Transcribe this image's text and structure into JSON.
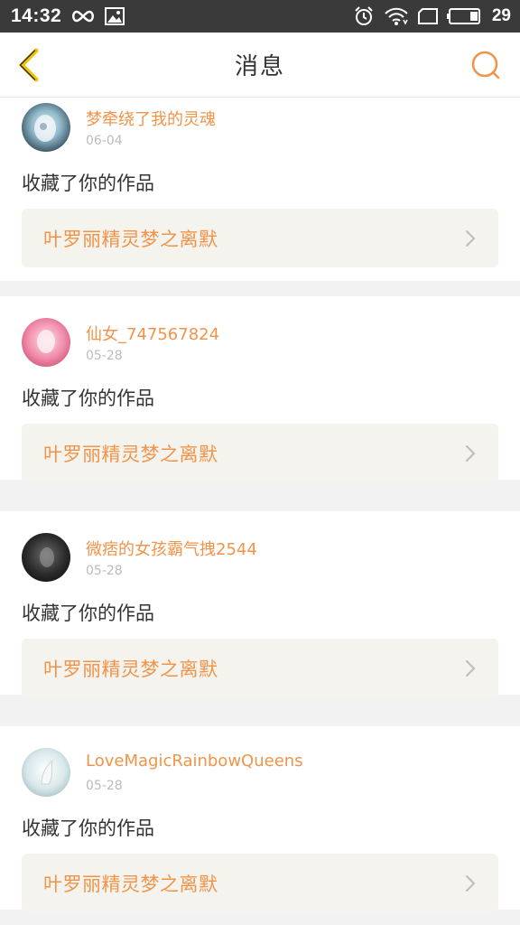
{
  "status_bar": {
    "time": "14:32",
    "battery": "29",
    "icons": [
      "infinity-icon",
      "image-icon",
      "alarm-icon",
      "wifi-icon",
      "screen-icon",
      "battery-icon"
    ]
  },
  "nav": {
    "title": "消息",
    "back_icon": "chevron-left-icon",
    "search_icon": "search-icon",
    "accent_color": "#f0944a"
  },
  "messages": [
    {
      "user": "梦牵绕了我的灵魂",
      "date": "06-04",
      "action": "收藏了你的作品",
      "work": "叶罗丽精灵梦之离默"
    },
    {
      "user": "仙女_747567824",
      "date": "05-28",
      "action": "收藏了你的作品",
      "work": "叶罗丽精灵梦之离默"
    },
    {
      "user": "微痞的女孩霸气拽2544",
      "date": "05-28",
      "action": "收藏了你的作品",
      "work": "叶罗丽精灵梦之离默"
    },
    {
      "user": "LoveMagicRainbowQueens",
      "date": "05-28",
      "action": "收藏了你的作品",
      "work": "叶罗丽精灵梦之离默"
    }
  ]
}
